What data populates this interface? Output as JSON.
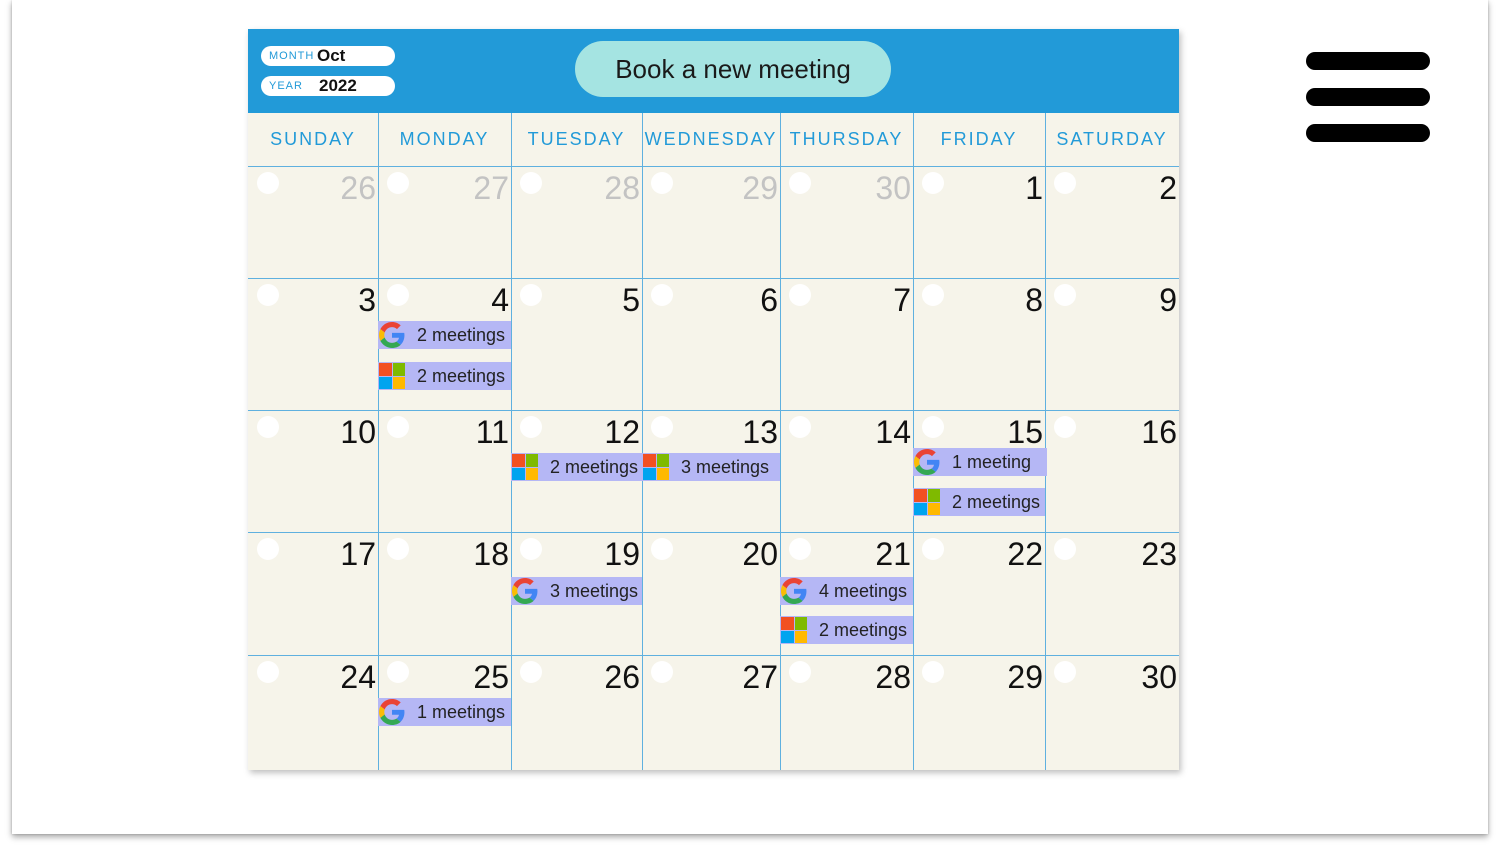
{
  "header": {
    "month_label": "MONTH",
    "month_value": "Oct",
    "year_label": "YEAR",
    "year_value": "2022",
    "book_button": "Book a new meeting"
  },
  "weekdays": [
    "SUNDAY",
    "MONDAY",
    "TUESDAY",
    "WEDNESDAY",
    "THURSDAY",
    "FRIDAY",
    "SATURDAY"
  ],
  "weeks": [
    [
      {
        "day": "26",
        "muted": true
      },
      {
        "day": "27",
        "muted": true
      },
      {
        "day": "28",
        "muted": true
      },
      {
        "day": "29",
        "muted": true
      },
      {
        "day": "30",
        "muted": true
      },
      {
        "day": "1"
      },
      {
        "day": "2"
      }
    ],
    [
      {
        "day": "3"
      },
      {
        "day": "4",
        "events": [
          {
            "provider": "google-icon",
            "label": "2 meetings"
          },
          {
            "provider": "microsoft-icon",
            "label": "2 meetings"
          }
        ]
      },
      {
        "day": "5"
      },
      {
        "day": "6"
      },
      {
        "day": "7"
      },
      {
        "day": "8"
      },
      {
        "day": "9"
      }
    ],
    [
      {
        "day": "10"
      },
      {
        "day": "11"
      },
      {
        "day": "12",
        "events": [
          {
            "provider": "microsoft-icon",
            "label": "2 meetings"
          }
        ]
      },
      {
        "day": "13",
        "events": [
          {
            "provider": "microsoft-icon",
            "label": "3 meetings"
          }
        ]
      },
      {
        "day": "14"
      },
      {
        "day": "15",
        "events": [
          {
            "provider": "google-icon",
            "label": "1 meeting"
          },
          {
            "provider": "microsoft-icon",
            "label": "2 meetings"
          }
        ]
      },
      {
        "day": "16"
      }
    ],
    [
      {
        "day": "17"
      },
      {
        "day": "18"
      },
      {
        "day": "19",
        "events": [
          {
            "provider": "google-icon",
            "label": "3 meetings"
          }
        ]
      },
      {
        "day": "20"
      },
      {
        "day": "21",
        "events": [
          {
            "provider": "google-icon",
            "label": "4 meetings"
          },
          {
            "provider": "microsoft-icon",
            "label": "2 meetings"
          }
        ]
      },
      {
        "day": "22"
      },
      {
        "day": "23"
      }
    ],
    [
      {
        "day": "24"
      },
      {
        "day": "25",
        "events": [
          {
            "provider": "google-icon",
            "label": "1 meetings"
          }
        ]
      },
      {
        "day": "26"
      },
      {
        "day": "27"
      },
      {
        "day": "28"
      },
      {
        "day": "29"
      },
      {
        "day": "30"
      }
    ]
  ],
  "menu_icon": "hamburger-menu-icon",
  "colors": {
    "header_blue": "#229ad8",
    "cell_bg": "#f6f4ea",
    "badge_bg": "#b5b7f5",
    "button_bg": "#a5e4e2",
    "muted_day": "#c3c3c3"
  }
}
